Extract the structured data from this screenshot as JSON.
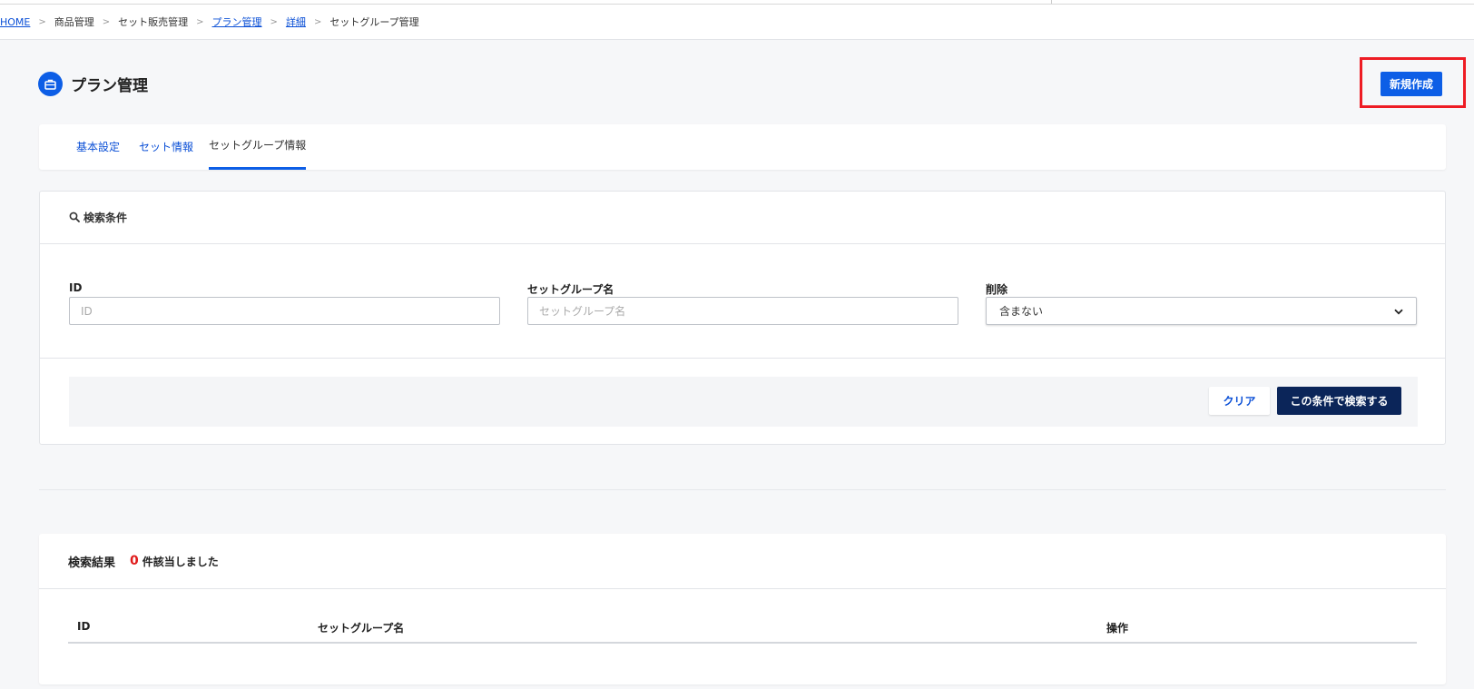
{
  "breadcrumb": [
    {
      "label": "HOME",
      "link": true
    },
    {
      "label": "商品管理",
      "link": false
    },
    {
      "label": "セット販売管理",
      "link": false
    },
    {
      "label": "プラン管理",
      "link": true
    },
    {
      "label": "詳細",
      "link": true
    },
    {
      "label": "セットグループ管理",
      "link": false
    }
  ],
  "breadcrumb_separator": ">",
  "page": {
    "title": "プラン管理",
    "icon": "briefcase-icon",
    "new_button_label": "新規作成"
  },
  "tabs": [
    {
      "label": "基本設定",
      "active": false
    },
    {
      "label": "セット情報",
      "active": false
    },
    {
      "label": "セットグループ情報",
      "active": true
    }
  ],
  "search": {
    "title": "検索条件",
    "fields": {
      "id": {
        "label": "ID",
        "placeholder": "ID",
        "value": ""
      },
      "group_name": {
        "label": "セットグループ名",
        "placeholder": "セットグループ名",
        "value": ""
      },
      "deleted": {
        "label": "削除",
        "selected": "含まない"
      }
    },
    "clear_label": "クリア",
    "submit_label": "この条件で検索する"
  },
  "results": {
    "title": "検索結果",
    "count": "0",
    "suffix": "件該当しました",
    "columns": [
      "ID",
      "セットグループ名",
      "操作"
    ]
  },
  "colors": {
    "primary": "#0d5ee6",
    "navy": "#0b2559",
    "highlight": "#ee1c24",
    "count": "#e01b1b"
  }
}
